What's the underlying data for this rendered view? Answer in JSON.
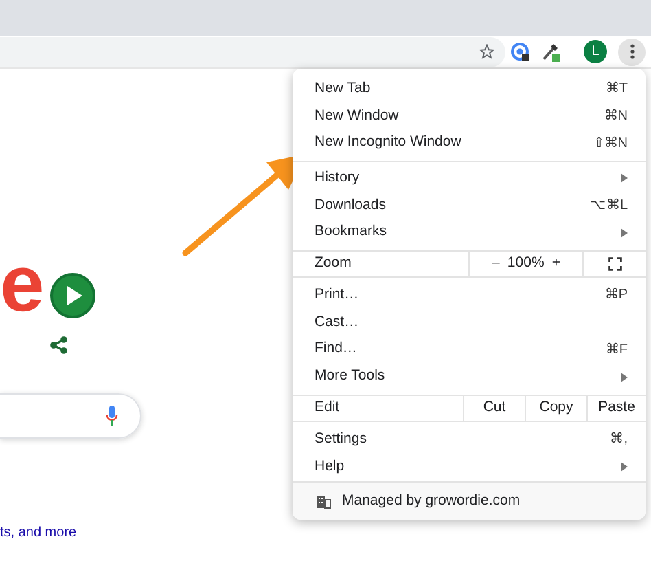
{
  "toolbar": {
    "avatar_letter": "L"
  },
  "page": {
    "logo_fragment": "e",
    "link_text": "ts, and more"
  },
  "menu": [
    {
      "kind": "item",
      "label": "New Tab",
      "shortcut": "⌘T",
      "submenu": false
    },
    {
      "kind": "item",
      "label": "New Window",
      "shortcut": "⌘N",
      "submenu": false
    },
    {
      "kind": "item",
      "label": "New Incognito Window",
      "shortcut": "⇧⌘N",
      "submenu": false
    },
    {
      "kind": "separator"
    },
    {
      "kind": "item",
      "label": "History",
      "submenu": true
    },
    {
      "kind": "item",
      "label": "Downloads",
      "shortcut": "⌥⌘L",
      "submenu": false
    },
    {
      "kind": "item",
      "label": "Bookmarks",
      "submenu": true
    },
    {
      "kind": "zoom",
      "label": "Zoom",
      "minus": "–",
      "value": "100%",
      "plus": "+"
    },
    {
      "kind": "item",
      "label": "Print…",
      "shortcut": "⌘P",
      "submenu": false
    },
    {
      "kind": "item",
      "label": "Cast…",
      "submenu": false
    },
    {
      "kind": "item",
      "label": "Find…",
      "shortcut": "⌘F",
      "submenu": false
    },
    {
      "kind": "item",
      "label": "More Tools",
      "submenu": true
    },
    {
      "kind": "edit",
      "label": "Edit",
      "cut": "Cut",
      "copy": "Copy",
      "paste": "Paste"
    },
    {
      "kind": "item",
      "label": "Settings",
      "shortcut": "⌘,",
      "submenu": false
    },
    {
      "kind": "item",
      "label": "Help",
      "submenu": true
    },
    {
      "kind": "footer",
      "text": "Managed by growordie.com"
    }
  ]
}
